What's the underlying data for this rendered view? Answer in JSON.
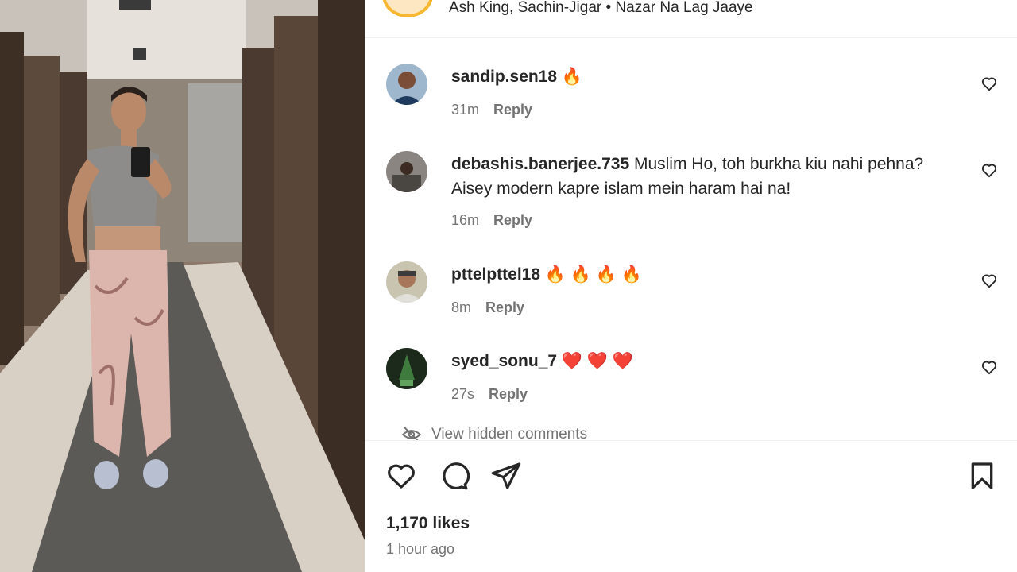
{
  "post": {
    "music_line": "Ash King, Sachin-Jigar • Nazar Na Lag Jaaye",
    "likes": "1,170 likes",
    "time_ago": "1 hour ago"
  },
  "comments": [
    {
      "username": "sandip.sen18",
      "text": "🔥",
      "time": "31m",
      "reply": "Reply",
      "avatar_color": "#7a8fa6"
    },
    {
      "username": "debashis.banerjee.735",
      "text": "Muslim Ho, toh burkha kiu nahi pehna? Aisey modern kapre islam mein haram hai na!",
      "time": "16m",
      "reply": "Reply",
      "avatar_color": "#6d6a66"
    },
    {
      "username": "pttelpttel18",
      "text": "🔥 🔥 🔥 🔥",
      "time": "8m",
      "reply": "Reply",
      "avatar_color": "#a9a48f"
    },
    {
      "username": "syed_sonu_7",
      "text": "❤️ ❤️ ❤️",
      "time": "27s",
      "reply": "Reply",
      "avatar_color": "#2f4a2f"
    }
  ],
  "hidden_comments": "View hidden comments",
  "icons": {
    "like": "heart-icon",
    "comment": "comment-icon",
    "share": "paper-plane-icon",
    "save": "bookmark-icon",
    "hidden": "eye-off-icon"
  }
}
